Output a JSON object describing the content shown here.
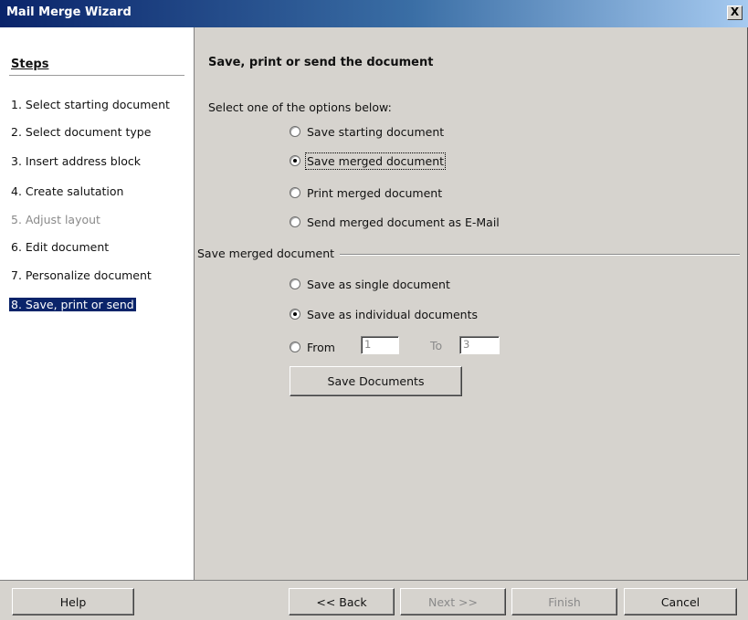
{
  "window": {
    "title": "Mail Merge Wizard",
    "close_glyph": "X"
  },
  "steps": {
    "heading": "Steps",
    "items": [
      {
        "label": "1. Select starting document",
        "state": "normal"
      },
      {
        "label": "2. Select document type",
        "state": "normal"
      },
      {
        "label": "3. Insert address block",
        "state": "normal"
      },
      {
        "label": "4. Create salutation",
        "state": "normal"
      },
      {
        "label": "5. Adjust layout",
        "state": "disabled"
      },
      {
        "label": "6. Edit document",
        "state": "normal"
      },
      {
        "label": "7. Personalize document",
        "state": "normal"
      },
      {
        "label": "8. Save, print or send",
        "state": "active"
      }
    ]
  },
  "page": {
    "heading": "Save, print or send the document",
    "intro": "Select one of the options below:",
    "options": [
      {
        "label": "Save starting document",
        "checked": false
      },
      {
        "label": "Save merged document",
        "checked": true
      },
      {
        "label": "Print merged document",
        "checked": false
      },
      {
        "label": "Send merged document as E-Mail",
        "checked": false
      }
    ],
    "group_label": "Save merged document",
    "save_options": [
      {
        "label": "Save as single document",
        "checked": false
      },
      {
        "label": "Save as individual documents",
        "checked": true
      }
    ],
    "range": {
      "from_label": "From",
      "from_value": "1",
      "to_label": "To",
      "to_value": "3"
    },
    "save_button": "Save Documents"
  },
  "footer": {
    "help": "Help",
    "back": "<< Back",
    "next": "Next >>",
    "finish": "Finish",
    "cancel": "Cancel"
  },
  "colors": {
    "title_bar_start": "#0a246a",
    "selection": "#0a246a",
    "dialog_bg": "#d6d3ce"
  }
}
